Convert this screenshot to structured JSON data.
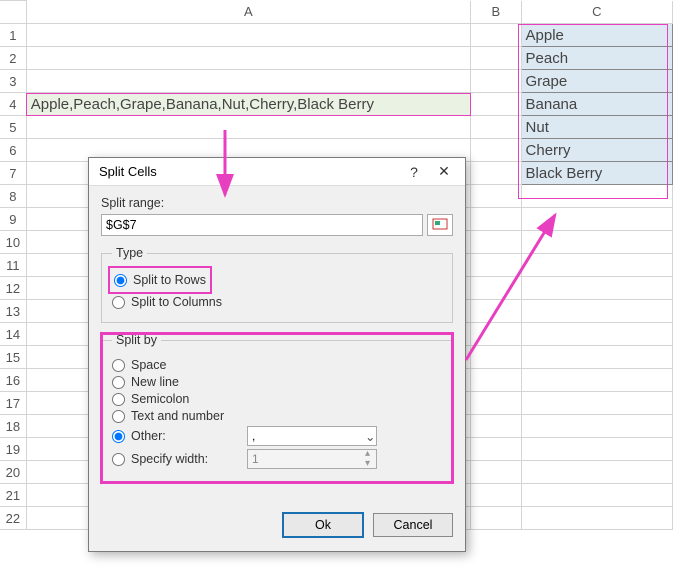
{
  "columns": [
    "A",
    "B",
    "C"
  ],
  "row_count": 22,
  "source_cell": "Apple,Peach,Grape,Banana,Nut,Cherry,Black Berry",
  "results": [
    "Apple",
    "Peach",
    "Grape",
    "Banana",
    "Nut",
    "Cherry",
    "Black Berry"
  ],
  "dialog": {
    "title": "Split Cells",
    "help": "?",
    "close": "✕",
    "split_range_label": "Split range:",
    "split_range_value": "$G$7",
    "type_legend": "Type",
    "type_rows": "Split to Rows",
    "type_cols": "Split to Columns",
    "splitby_legend": "Split by",
    "opt_space": "Space",
    "opt_newline": "New line",
    "opt_semicolon": "Semicolon",
    "opt_textnum": "Text and number",
    "opt_other": "Other:",
    "other_value": ",",
    "opt_width": "Specify width:",
    "width_value": "1",
    "ok": "Ok",
    "cancel": "Cancel"
  }
}
